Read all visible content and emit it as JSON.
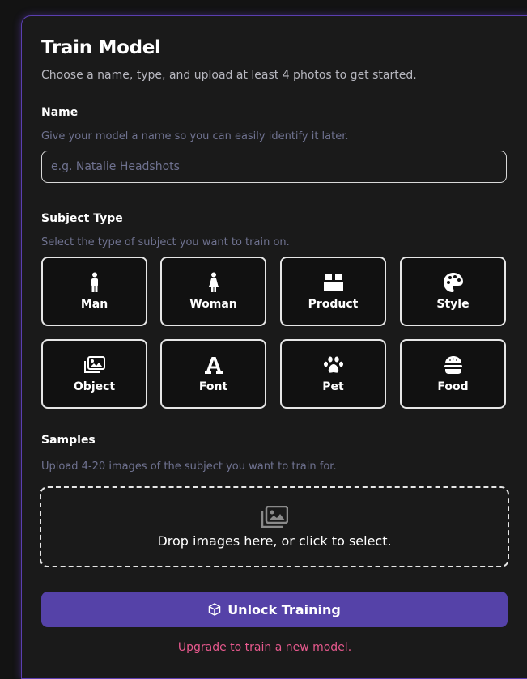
{
  "form": {
    "title": "Train Model",
    "subtitle": "Choose a name, type, and upload at least 4 photos to get started."
  },
  "name_section": {
    "label": "Name",
    "help": "Give your model a name so you can easily identify it later.",
    "value": "",
    "placeholder": "e.g. Natalie Headshots"
  },
  "subject_section": {
    "label": "Subject Type",
    "help": "Select the type of subject you want to train on.",
    "options": [
      {
        "label": "Man",
        "icon": "man-icon"
      },
      {
        "label": "Woman",
        "icon": "woman-icon"
      },
      {
        "label": "Product",
        "icon": "box-icon"
      },
      {
        "label": "Style",
        "icon": "palette-icon"
      },
      {
        "label": "Object",
        "icon": "images-icon"
      },
      {
        "label": "Font",
        "icon": "font-icon"
      },
      {
        "label": "Pet",
        "icon": "paw-icon"
      },
      {
        "label": "Food",
        "icon": "burger-icon"
      }
    ]
  },
  "samples_section": {
    "label": "Samples",
    "help": "Upload 4-20 images of the subject you want to train for.",
    "dropzone_text": "Drop images here, or click to select.",
    "dropzone_icon": "images-icon"
  },
  "action": {
    "button_label": "Unlock Training",
    "button_icon": "cube-icon",
    "button_color": "#5542a8",
    "upgrade_text": "Upgrade to train a new model.",
    "upgrade_color": "#e8598e"
  }
}
